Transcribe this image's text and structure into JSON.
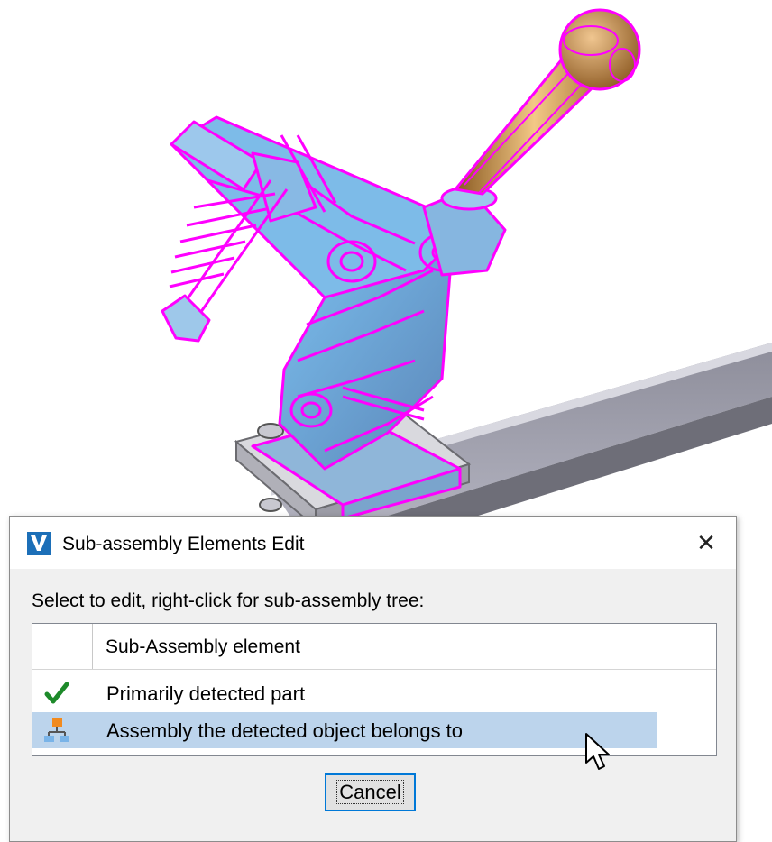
{
  "dialog": {
    "title": "Sub-assembly Elements Edit",
    "app_icon_text": "VariCAD",
    "close_label": "✕",
    "instruction": "Select to edit, right-click for sub-assembly tree:",
    "list": {
      "header": "Sub-Assembly element",
      "rows": [
        {
          "label": "Primarily detected part",
          "icon": "checkmark-icon",
          "selected": false
        },
        {
          "label": "Assembly the detected object belongs to",
          "icon": "assembly-tree-icon",
          "selected": true
        }
      ]
    },
    "cancel_label": "Cancel"
  },
  "colors": {
    "highlight_wireframe": "#ff00ff",
    "selection": "#bcd4ec",
    "accent_border": "#0078d7",
    "handle_bronze": "#c8894a",
    "check_green": "#1d8a2a"
  }
}
